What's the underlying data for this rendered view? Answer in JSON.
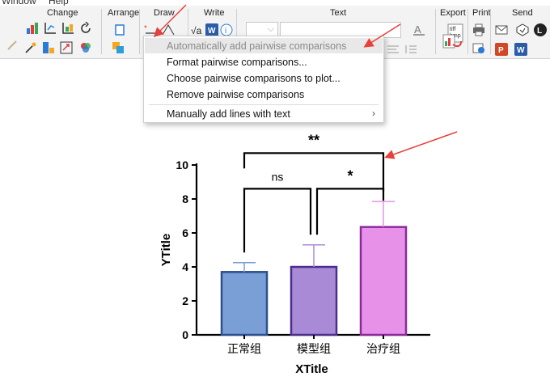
{
  "menubar": {
    "window": "Window",
    "help": "Help"
  },
  "ribbon": {
    "groups": [
      "Change",
      "Arrange",
      "Draw",
      "Write",
      "Text",
      "Export",
      "Print",
      "Send"
    ],
    "write_sqrt": "√a",
    "write_w": "W",
    "export_tiff": "tiff",
    "export_bmp": "bmp",
    "send_p": "P",
    "send_w": "W",
    "send_l": "L"
  },
  "context_menu": {
    "items": [
      {
        "label": "Automatically add pairwise comparisons",
        "enabled": false
      },
      {
        "label": "Format pairwise comparisons...",
        "enabled": true
      },
      {
        "label": "Choose pairwise comparisons to plot...",
        "enabled": true
      },
      {
        "label": "Remove pairwise comparisons",
        "enabled": true
      },
      {
        "label": "Manually add lines with text",
        "enabled": true,
        "submenu": true
      }
    ],
    "submenu_glyph": "›"
  },
  "chart_data": {
    "type": "bar",
    "categories": [
      "正常组",
      "模型组",
      "治疗组"
    ],
    "values": [
      3.7,
      4.0,
      6.35
    ],
    "errors": [
      0.55,
      1.3,
      1.5
    ],
    "bar_colors": [
      "#7a9fd6",
      "#a98ad6",
      "#e891e8"
    ],
    "bar_edges": [
      "#2c4f8f",
      "#4a2f8c",
      "#8a2a9a"
    ],
    "ylim": [
      0,
      10
    ],
    "yticks": [
      0,
      2,
      4,
      6,
      8,
      10
    ],
    "xlabel": "XTitle",
    "ylabel": "YTitle",
    "comparisons": [
      {
        "from": 0,
        "to": 1,
        "label": "ns",
        "level": 8.6
      },
      {
        "from": 1,
        "to": 2,
        "label": "*",
        "level": 8.6
      },
      {
        "from": 0,
        "to": 2,
        "label": "**",
        "level": 10.7
      }
    ]
  },
  "annotation_color": "#e8403a"
}
